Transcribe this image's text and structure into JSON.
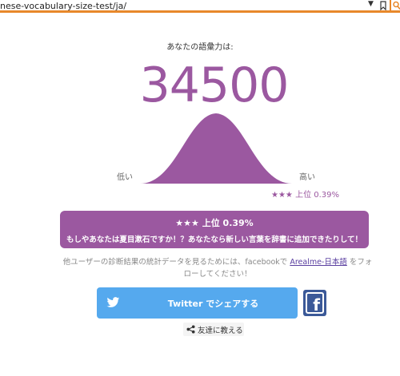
{
  "browser": {
    "url": "nese-vocabulary-size-test/ja/",
    "dropdown_glyph": "▼"
  },
  "result": {
    "heading": "あなたの語彙力は:",
    "score": "34500",
    "low_label": "低い",
    "high_label": "高い",
    "rank_small": "★★★ 上位 0.39%",
    "box_title": "★★★ 上位 0.39%",
    "box_subtitle": "もしやあなたは夏目漱石ですか！？あなたなら新しい言葉を辞書に追加できたりして！"
  },
  "follow": {
    "prefix": "他ユーザーの診断結果の統計データを見るためには、facebookで ",
    "link": "Arealme-日本語",
    "suffix": " をフォローしてください！"
  },
  "share": {
    "twitter_label": "Twitter でシェアする",
    "facebook_glyph": "f",
    "friends_label": "友達に教える"
  },
  "colors": {
    "accent_purple": "#9b58a0",
    "twitter_blue": "#55a9ee",
    "facebook_blue": "#3b5998",
    "browser_orange": "#e8882a"
  }
}
